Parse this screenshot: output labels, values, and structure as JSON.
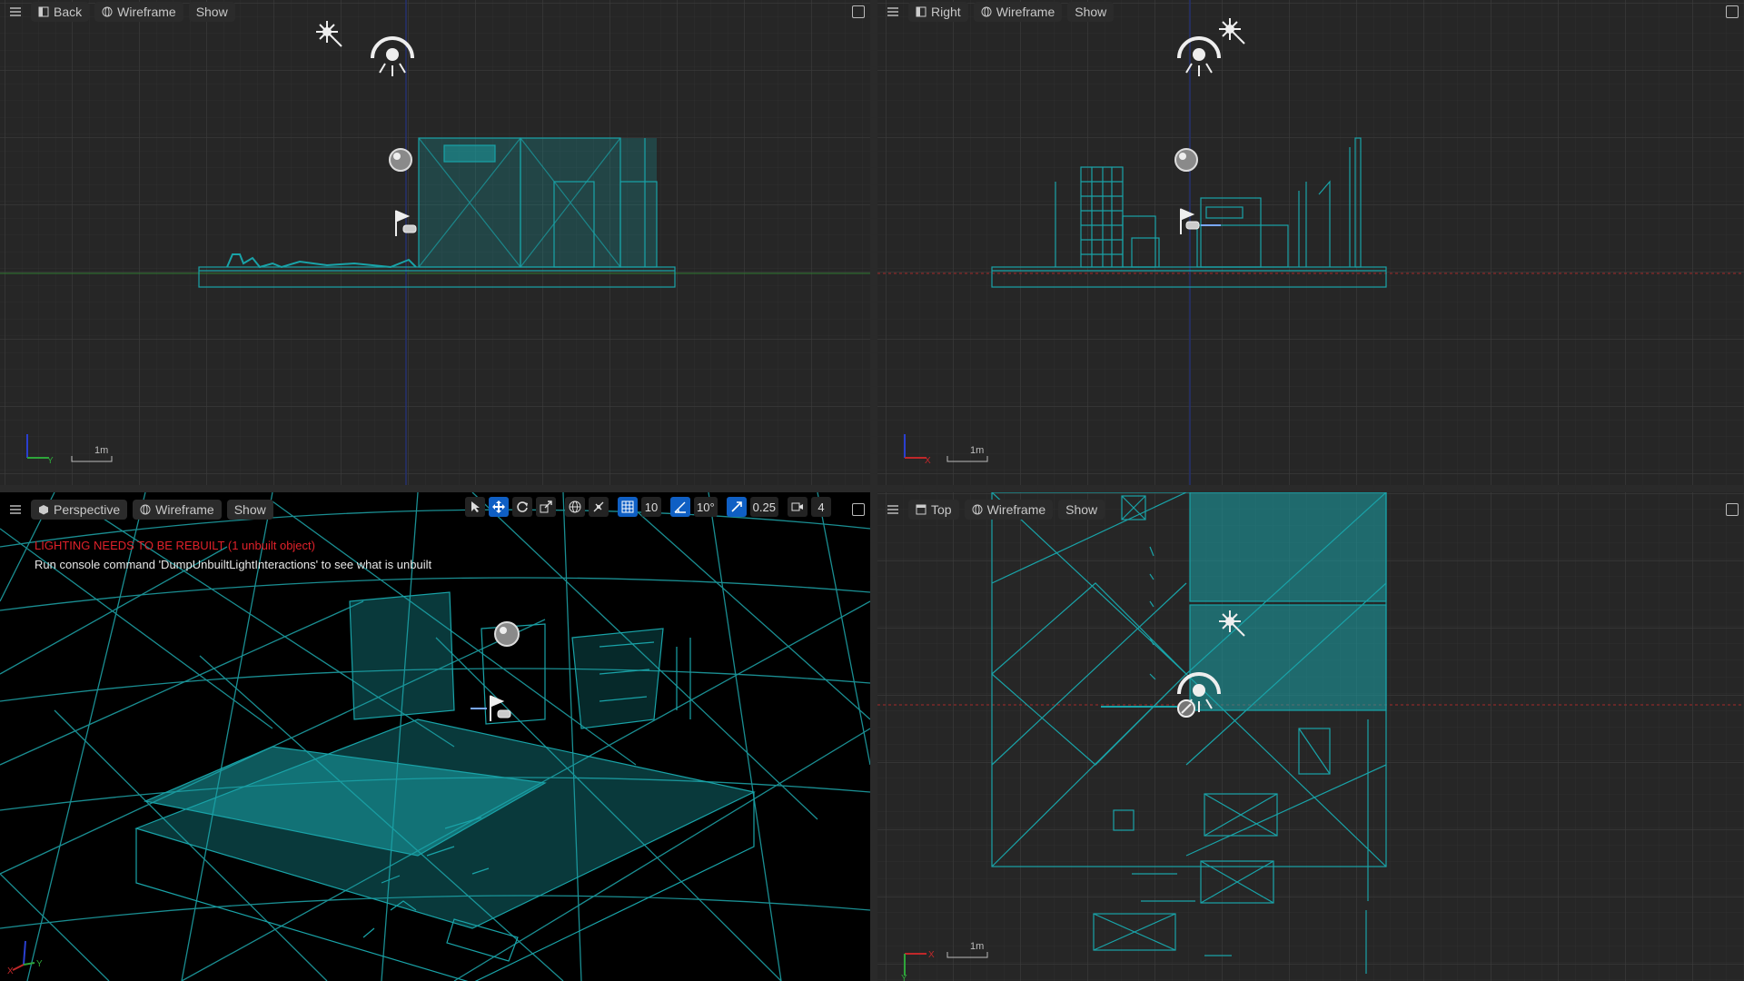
{
  "viewports": {
    "back": {
      "view_label": "Back",
      "mode_label": "Wireframe",
      "show_label": "Show",
      "scale_label": "1m",
      "axis_labels": [
        "Z",
        "Y"
      ]
    },
    "right": {
      "view_label": "Right",
      "mode_label": "Wireframe",
      "show_label": "Show",
      "scale_label": "1m",
      "axis_labels": [
        "Z",
        "X"
      ]
    },
    "perspective": {
      "view_label": "Perspective",
      "mode_label": "Wireframe",
      "show_label": "Show",
      "warning": "LIGHTING NEEDS TO BE REBUILT (1 unbuilt object)",
      "hint": "Run console command 'DumpUnbuiltLightInteractions' to see what is unbuilt",
      "axis_labels": [
        "X",
        "Y"
      ]
    },
    "top": {
      "view_label": "Top",
      "mode_label": "Wireframe",
      "show_label": "Show",
      "scale_label": "1m",
      "axis_labels": [
        "X",
        "Y"
      ]
    }
  },
  "transform_toolbar": {
    "grid_snap_value": "10",
    "rotation_snap_value": "10°",
    "scale_snap_value": "0.25",
    "camera_speed_value": "4",
    "icons": [
      "select-icon",
      "translate-icon",
      "rotate-icon",
      "scale-icon",
      "world-space-icon",
      "surface-snap-icon",
      "grid-snap-icon",
      "rotation-snap-icon",
      "scale-snap-icon",
      "camera-speed-icon"
    ]
  },
  "colors": {
    "viewport_bg": "#262626",
    "perspective_bg": "#000000",
    "wireframe": "#19a3a8",
    "grid_major": "#3b3b3b",
    "grid_minor": "#2f2f2f",
    "warning_text": "#e0212a",
    "axis_red": "#c0282a",
    "axis_green": "#2e9a3a",
    "axis_blue": "#24368c",
    "active_tool": "#0f5fc4"
  }
}
